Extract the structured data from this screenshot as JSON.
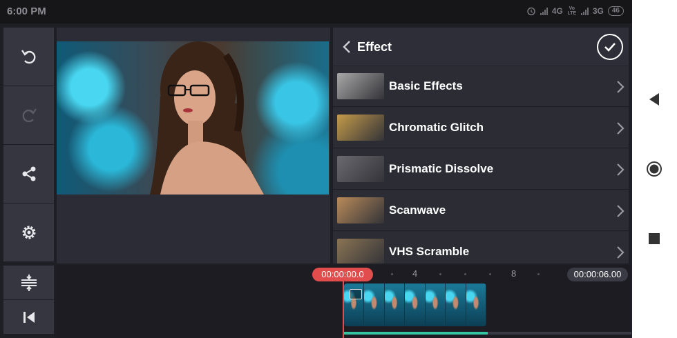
{
  "status_bar": {
    "time": "6:00 PM",
    "network1": "4G",
    "volte": "Vo LTE",
    "network2": "3G",
    "battery": "46",
    "icons": [
      "alarm-icon",
      "signal-icon",
      "signal-icon"
    ]
  },
  "toolbar": {
    "items": [
      {
        "name": "undo",
        "icon": "undo-icon",
        "enabled": true
      },
      {
        "name": "redo",
        "icon": "redo-icon",
        "enabled": false
      },
      {
        "name": "share",
        "icon": "share-icon",
        "enabled": true
      },
      {
        "name": "settings",
        "icon": "gear-icon",
        "enabled": true
      }
    ],
    "bottom_items": [
      {
        "name": "layers",
        "icon": "layers-icon"
      },
      {
        "name": "skip-to-start",
        "icon": "skip-start-icon"
      }
    ]
  },
  "effect_panel": {
    "title": "Effect",
    "items": [
      {
        "label": "Basic Effects",
        "thumb": "#a8a8a8"
      },
      {
        "label": "Chromatic Glitch",
        "thumb": "#c49b4a"
      },
      {
        "label": "Prismatic Dissolve",
        "thumb": "#6a6a70"
      },
      {
        "label": "Scanwave",
        "thumb": "#b98b5a"
      },
      {
        "label": "VHS Scramble",
        "thumb": "#8a7454"
      }
    ]
  },
  "timeline": {
    "current_time": "00:00:00.0",
    "end_time": "00:00:06.00",
    "tick_labels": [
      "4",
      "8"
    ],
    "progress": 0.5
  },
  "colors": {
    "accent_red": "#e14c4c",
    "accent_green": "#34c5a3",
    "panel_bg": "#2a2a33"
  }
}
